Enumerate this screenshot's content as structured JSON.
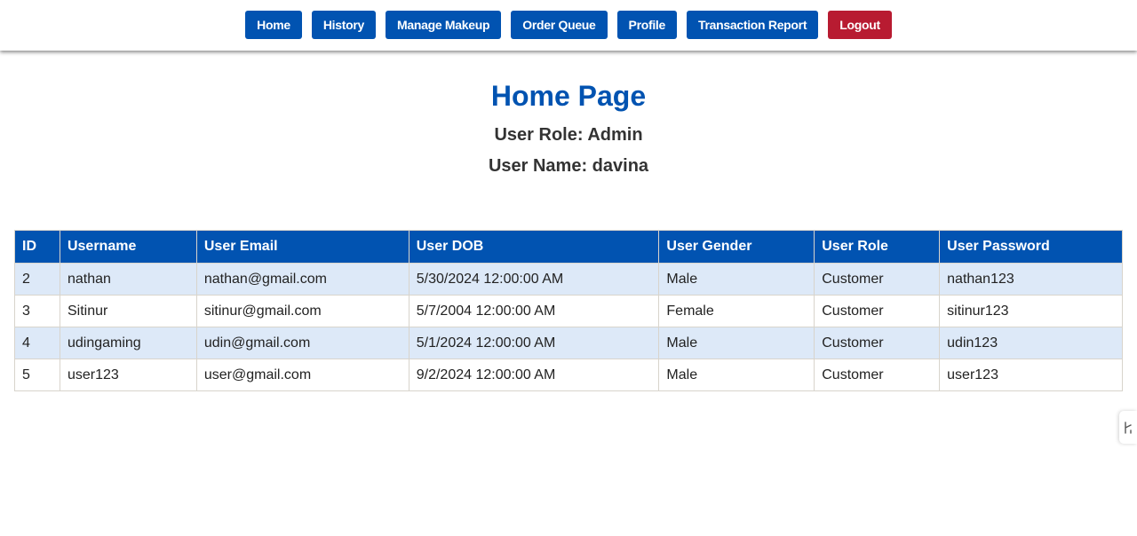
{
  "nav": {
    "items": [
      {
        "label": "Home"
      },
      {
        "label": "History"
      },
      {
        "label": "Manage Makeup"
      },
      {
        "label": "Order Queue"
      },
      {
        "label": "Profile"
      },
      {
        "label": "Transaction Report"
      }
    ],
    "logout_label": "Logout"
  },
  "page": {
    "title": "Home Page",
    "role_line": "User Role: Admin",
    "name_line": "User Name: davina"
  },
  "table": {
    "headers": [
      "ID",
      "Username",
      "User Email",
      "User DOB",
      "User Gender",
      "User Role",
      "User Password"
    ],
    "rows": [
      [
        "2",
        "nathan",
        "nathan@gmail.com",
        "5/30/2024 12:00:00 AM",
        "Male",
        "Customer",
        "nathan123"
      ],
      [
        "3",
        "Sitinur",
        "sitinur@gmail.com",
        "5/7/2004 12:00:00 AM",
        "Female",
        "Customer",
        "sitinur123"
      ],
      [
        "4",
        "udingaming",
        "udin@gmail.com",
        "5/1/2024 12:00:00 AM",
        "Male",
        "Customer",
        "udin123"
      ],
      [
        "5",
        "user123",
        "user@gmail.com",
        "9/2/2024 12:00:00 AM",
        "Male",
        "Customer",
        "user123"
      ]
    ]
  },
  "colors": {
    "primary": "#0153b1",
    "danger": "#b81b31",
    "row_alt": "#dde9f8",
    "text_dark": "#333333"
  },
  "icons": {
    "side_handle": "resize-handle-icon"
  }
}
